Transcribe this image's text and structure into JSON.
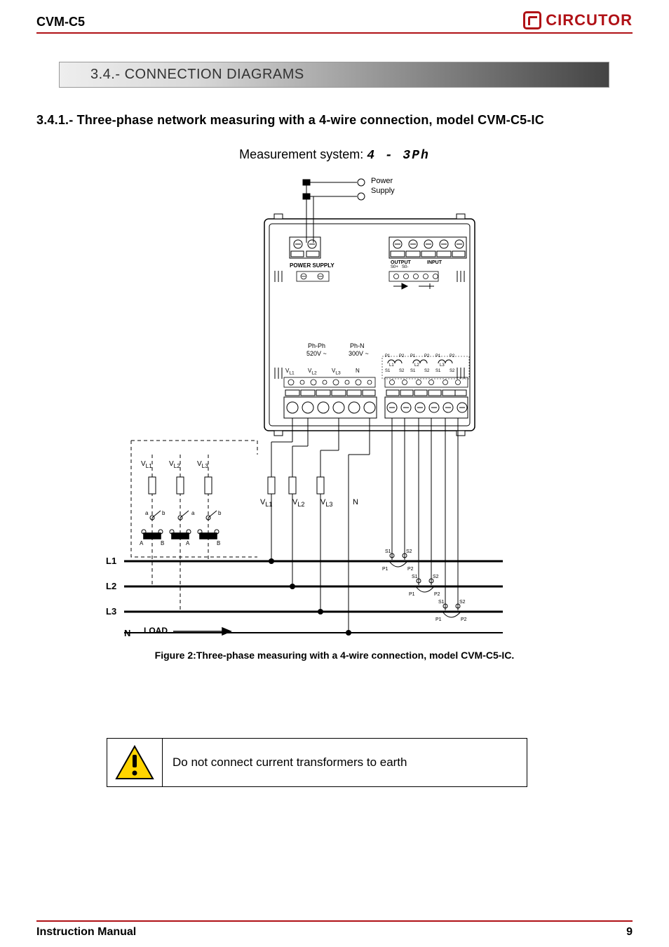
{
  "header": {
    "doc_code": "CVM-C5",
    "brand": "CIRCUTOR"
  },
  "section": {
    "number": "3.4.-",
    "title": "CONNECTION DIAGRAMS"
  },
  "subsection": {
    "number": "3.4.1.-",
    "title": "Three-phase network measuring with a 4-wire connection, model CVM-C5-IC"
  },
  "measurement": {
    "label": "Measurement system:",
    "value": "4 - 3Ph"
  },
  "diagram": {
    "power_supply_label": "Power Supply",
    "power_supply_block": "POWER SUPPLY",
    "output": "OUTPUT",
    "input": "INPUT",
    "s0p": "S0+",
    "s0m": "S0-",
    "phph": "Ph-Ph",
    "phph_v": "520V ~",
    "phn": "Ph-N",
    "phn_v": "300V ~",
    "vl1": "VL1",
    "vl2": "VL2",
    "vl3": "VL3",
    "n": "N",
    "p1": "P1",
    "p2": "P2",
    "s1": "S1",
    "s2": "S2",
    "l1": "L1",
    "l2": "L2",
    "l3": "L3",
    "ct_L1": "L1",
    "ct_L2": "L2",
    "ct_L3": "L3",
    "load": "LOAD",
    "a": "a",
    "b": "b",
    "A": "A",
    "B": "B"
  },
  "figure_caption": "Figure 2:Three-phase measuring with a 4-wire connection, model CVM-C5-IC.",
  "warning_text": "Do not connect current transformers to earth",
  "footer": {
    "left": "Instruction Manual",
    "right": "9"
  }
}
